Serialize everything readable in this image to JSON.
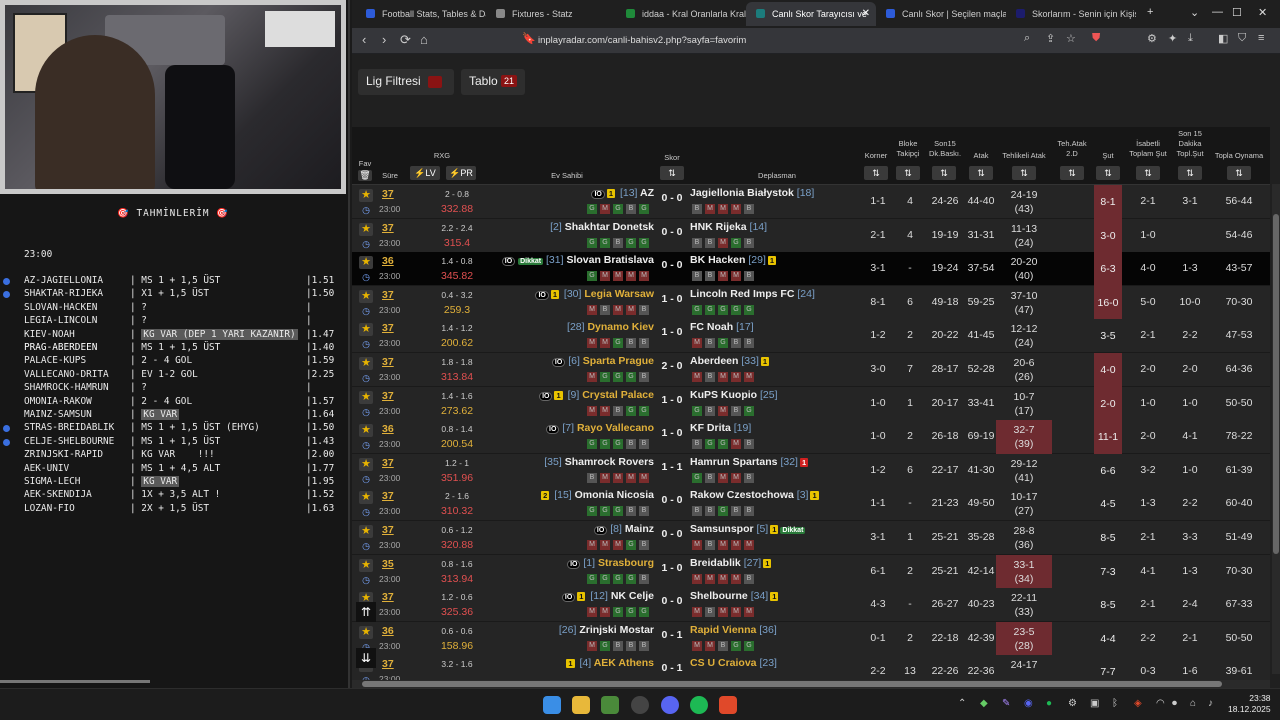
{
  "predictions": {
    "title": "🎯 TAHMİNLERİM 🎯",
    "time": "23:00",
    "items": [
      {
        "match": "AZ-JAGIELLONIA",
        "bet": "MS 1 + 1,5 ÜST",
        "odds": "1.51",
        "dot": true,
        "kg": false
      },
      {
        "match": "SHAKTAR-RIJEKA",
        "bet": "X1 + 1,5 ÜST",
        "odds": "1.50",
        "dot": true,
        "kg": false
      },
      {
        "match": "SLOVAN-HACKEN",
        "bet": "?",
        "odds": "",
        "dot": false,
        "kg": false
      },
      {
        "match": "LEGIA-LINCOLN",
        "bet": "?",
        "odds": "",
        "dot": false,
        "kg": false
      },
      {
        "match": "KIEV-NOAH",
        "bet": "KG VAR (DEP 1 YARI KAZANIR)",
        "odds": "1.47",
        "dot": false,
        "kg": true
      },
      {
        "match": "PRAG-ABERDEEN",
        "bet": "MS 1 + 1,5 ÜST",
        "odds": "1.40",
        "dot": false,
        "kg": false,
        "hl": true
      },
      {
        "match": "PALACE-KUPS",
        "bet": "2 - 4 GOL",
        "odds": "1.59",
        "dot": false,
        "kg": false
      },
      {
        "match": "VALLECANO-DRITA",
        "bet": "EV 1-2 GOL",
        "odds": "2.25",
        "dot": false,
        "kg": false
      },
      {
        "match": "SHAMROCK-HAMRUN",
        "bet": "?",
        "odds": "",
        "dot": false,
        "kg": false
      },
      {
        "match": "OMONIA-RAKOW",
        "bet": "2 - 4 GOL",
        "odds": "1.57",
        "dot": false,
        "kg": false
      },
      {
        "match": "MAINZ-SAMSUN",
        "bet": "KG VAR",
        "odds": "1.64",
        "dot": false,
        "kg": true
      },
      {
        "match": "STRAS-BREIDABLIK",
        "bet": "MS 1 + 1,5 ÜST (EHYG)",
        "odds": "1.50",
        "dot": true,
        "kg": false
      },
      {
        "match": "CELJE-SHELBOURNE",
        "bet": "MS 1 + 1,5 ÜST",
        "odds": "1.43",
        "dot": true,
        "kg": false
      },
      {
        "match": "ZRINJSKI-RAPID",
        "bet": "KG VAR    !!!",
        "odds": "2.00",
        "dot": false,
        "kg": false
      },
      {
        "match": "AEK-UNIV",
        "bet": "MS 1 + 4,5 ALT",
        "odds": "1.77",
        "dot": false,
        "kg": false
      },
      {
        "match": "SIGMA-LECH",
        "bet": "KG VAR",
        "odds": "1.95",
        "dot": false,
        "kg": true
      },
      {
        "match": "AEK-SKENDIJA",
        "bet": "1X + 3,5 ALT !",
        "odds": "1.52",
        "dot": false,
        "kg": false
      },
      {
        "match": "LOZAN-FIO",
        "bet": "2X + 1,5 ÜST",
        "odds": "1.63",
        "dot": false,
        "kg": false
      }
    ]
  },
  "browser": {
    "tabs": [
      {
        "label": "Football Stats, Tables & Dat",
        "color": "#2d5bd8"
      },
      {
        "label": "Fixtures - Statz",
        "color": "#888"
      },
      {
        "label": "iddaa - Kral Oranlarla Kralla",
        "color": "#1f8a3a"
      },
      {
        "label": "Canlı Skor Tarayıcısı ve",
        "color": "#1c7c7c",
        "active": true
      },
      {
        "label": "Canlı Skor | Seçilen maçlar",
        "color": "#2d5bd8"
      },
      {
        "label": "Skorlarım - Senin için Kişise",
        "color": "#1c1c6c"
      }
    ],
    "url": "inplayradar.com/canli-bahisv2.php?sayfa=favorim"
  },
  "toolbar": {
    "lig_label": "Lig Filtresi",
    "tablo_label": "Tablo",
    "tablo_count": "21"
  },
  "headers": {
    "fav": "Fav",
    "sure": "Süre",
    "rxg": "RXG",
    "lv": "⚡LV",
    "pr": "⚡PR",
    "ev": "Ev Sahibi",
    "skor": "Skor",
    "dep": "Deplasman",
    "korner": "Korner",
    "bloke": "Bloke Takipçi",
    "son15": "Son15 Dk.Baskı.",
    "atak": "Atak",
    "tehlikeli": "Tehlikeli Atak",
    "teh2d": "Teh.Atak 2.D",
    "sut": "Şut",
    "isabetli": "İsabetli Toplam Şut",
    "son15sut": "Son 15 Dakika Topl.Şut",
    "topla": "Topla Oynama"
  },
  "matches": [
    {
      "min": "37",
      "ko": "23:00",
      "xg": "2 - 0.8",
      "pr": "332.88",
      "home": "AZ",
      "hrank": "[13]",
      "hcards": "1",
      "hio": true,
      "score": "0 - 0",
      "away": "Jagiellonia Białystok",
      "arank": "[18]",
      "hform": [
        "G",
        "M",
        "G",
        "B",
        "G"
      ],
      "aform": [
        "B",
        "M",
        "M",
        "M",
        "B"
      ],
      "korner": "1-1",
      "bloke": "4",
      "son15": "24-26",
      "atak": "44-40",
      "teh": "24-19",
      "teh2": "(43)",
      "sut": "8-1",
      "isa": "2-1",
      "s15": "3-1",
      "top": "56-44",
      "hotsut": true
    },
    {
      "min": "37",
      "ko": "23:00",
      "xg": "2.2 - 2.4",
      "pr": "315.4",
      "home": "Shakhtar Donetsk",
      "hrank": "[2]",
      "score": "0 - 0",
      "away": "HNK Rijeka",
      "arank": "[14]",
      "hform": [
        "G",
        "G",
        "B",
        "G",
        "G"
      ],
      "aform": [
        "B",
        "B",
        "M",
        "G",
        "B"
      ],
      "korner": "2-1",
      "bloke": "4",
      "son15": "19-19",
      "atak": "31-31",
      "teh": "11-13",
      "teh2": "(24)",
      "sut": "3-0",
      "isa": "1-0",
      "s15": "",
      "top": "54-46",
      "hotsut": true
    },
    {
      "min": "36",
      "ko": "23:00",
      "xg": "1.4 - 0.8",
      "pr": "345.82",
      "home": "Slovan Bratislava",
      "hrank": "[31]",
      "hio": true,
      "hdk": "Dikkat",
      "score": "0 - 0",
      "away": "BK Hacken",
      "arank": "[29]",
      "acards": "1",
      "hform": [
        "G",
        "M",
        "M",
        "M",
        "M"
      ],
      "aform": [
        "B",
        "B",
        "M",
        "M",
        "B"
      ],
      "korner": "3-1",
      "bloke": "-",
      "son15": "19-24",
      "atak": "37-54",
      "teh": "20-20",
      "teh2": "(40)",
      "sut": "6-3",
      "isa": "4-0",
      "s15": "1-3",
      "top": "43-57",
      "sel": true,
      "hotsut": true
    },
    {
      "min": "37",
      "ko": "23:00",
      "xg": "0.4 - 3.2",
      "pr": "259.3",
      "home": "Legia Warsaw",
      "hrank": "[30]",
      "hcards": "1",
      "hio": true,
      "score": "1 - 0",
      "away": "Lincoln Red Imps FC",
      "arank": "[24]",
      "hform": [
        "M",
        "B",
        "M",
        "M",
        "B"
      ],
      "aform": [
        "G",
        "G",
        "G",
        "G",
        "G"
      ],
      "korner": "8-1",
      "bloke": "6",
      "son15": "49-18",
      "atak": "59-25",
      "teh": "37-10",
      "teh2": "(47)",
      "sut": "16-0",
      "isa": "5-0",
      "s15": "10-0",
      "top": "70-30",
      "hotsut": true,
      "hotson": true,
      "gold": true
    },
    {
      "min": "37",
      "ko": "23:00",
      "xg": "1.4 - 1.2",
      "pr": "200.62",
      "home": "Dynamo Kiev",
      "hrank": "[28]",
      "score": "1 - 0",
      "away": "FC Noah",
      "arank": "[17]",
      "hform": [
        "M",
        "M",
        "G",
        "B",
        "B"
      ],
      "aform": [
        "M",
        "B",
        "G",
        "B",
        "B"
      ],
      "korner": "1-2",
      "bloke": "2",
      "son15": "20-22",
      "atak": "41-45",
      "teh": "12-12",
      "teh2": "(24)",
      "sut": "3-5",
      "isa": "2-1",
      "s15": "2-2",
      "top": "47-53",
      "gold": true
    },
    {
      "min": "37",
      "ko": "23:00",
      "xg": "1.8 - 1.8",
      "pr": "313.84",
      "home": "Sparta Prague",
      "hrank": "[6]",
      "hio": true,
      "score": "2 - 0",
      "away": "Aberdeen",
      "arank": "[33]",
      "acards": "1",
      "hform": [
        "M",
        "G",
        "G",
        "G",
        "B"
      ],
      "aform": [
        "M",
        "B",
        "M",
        "M",
        "M"
      ],
      "korner": "3-0",
      "bloke": "7",
      "son15": "28-17",
      "atak": "52-28",
      "teh": "20-6",
      "teh2": "(26)",
      "sut": "4-0",
      "isa": "2-0",
      "s15": "2-0",
      "top": "64-36",
      "hotsut": true,
      "hotson": true,
      "gold": true
    },
    {
      "min": "37",
      "ko": "23:00",
      "xg": "1.4 - 1.6",
      "pr": "273.62",
      "home": "Crystal Palace",
      "hrank": "[9]",
      "hcards": "1",
      "hio": true,
      "score": "1 - 0",
      "away": "KuPS Kuopio",
      "arank": "[25]",
      "hform": [
        "M",
        "M",
        "B",
        "G",
        "G"
      ],
      "aform": [
        "G",
        "B",
        "M",
        "B",
        "G"
      ],
      "korner": "1-0",
      "bloke": "1",
      "son15": "20-17",
      "atak": "33-41",
      "teh": "10-7",
      "teh2": "(17)",
      "sut": "2-0",
      "isa": "1-0",
      "s15": "1-0",
      "top": "50-50",
      "hotsut": true,
      "gold": true
    },
    {
      "min": "36",
      "ko": "23:00",
      "xg": "0.8 - 1.4",
      "pr": "200.54",
      "home": "Rayo Vallecano",
      "hrank": "[7]",
      "hio": true,
      "score": "1 - 0",
      "away": "KF Drita",
      "arank": "[19]",
      "hform": [
        "G",
        "G",
        "G",
        "B",
        "B"
      ],
      "aform": [
        "B",
        "G",
        "G",
        "M",
        "B"
      ],
      "korner": "1-0",
      "bloke": "2",
      "son15": "26-18",
      "atak": "69-19",
      "teh": "32-7",
      "teh2": "(39)",
      "sut": "11-1",
      "isa": "2-0",
      "s15": "4-1",
      "top": "78-22",
      "hotsut": true,
      "hotteh": true,
      "gold": true
    },
    {
      "min": "37",
      "ko": "23:00",
      "xg": "1.2 - 1",
      "pr": "351.96",
      "home": "Shamrock Rovers",
      "hrank": "[35]",
      "score": "1 - 1",
      "away": "Hamrun Spartans",
      "arank": "[32]",
      "arcards": "1",
      "hform": [
        "B",
        "M",
        "M",
        "M",
        "M"
      ],
      "aform": [
        "G",
        "B",
        "M",
        "M",
        "B"
      ],
      "korner": "1-2",
      "bloke": "6",
      "son15": "22-17",
      "atak": "41-30",
      "teh": "29-12",
      "teh2": "(41)",
      "sut": "6-6",
      "isa": "3-2",
      "s15": "1-0",
      "top": "61-39"
    },
    {
      "min": "37",
      "ko": "23:00",
      "xg": "2 - 1.6",
      "pr": "310.32",
      "home": "Omonia Nicosia",
      "hrank": "[15]",
      "hcards": "2",
      "score": "0 - 0",
      "away": "Rakow Czestochowa",
      "arank": "[3]",
      "acards": "1",
      "hform": [
        "G",
        "G",
        "G",
        "B",
        "B"
      ],
      "aform": [
        "B",
        "B",
        "G",
        "B",
        "B"
      ],
      "korner": "1-1",
      "bloke": "-",
      "son15": "21-23",
      "atak": "49-50",
      "teh": "10-17",
      "teh2": "(27)",
      "sut": "4-5",
      "isa": "1-3",
      "s15": "2-2",
      "top": "60-40"
    },
    {
      "min": "37",
      "ko": "23:00",
      "xg": "0.6 - 1.2",
      "pr": "320.88",
      "home": "Mainz",
      "hrank": "[8]",
      "hio": true,
      "score": "0 - 0",
      "away": "Samsunspor",
      "arank": "[5]",
      "acards": "1",
      "adk": "Dikkat",
      "hform": [
        "M",
        "M",
        "M",
        "G",
        "B"
      ],
      "aform": [
        "M",
        "B",
        "M",
        "M",
        "M"
      ],
      "korner": "3-1",
      "bloke": "1",
      "son15": "25-21",
      "atak": "35-28",
      "teh": "28-8",
      "teh2": "(36)",
      "sut": "8-5",
      "isa": "2-1",
      "s15": "3-3",
      "top": "51-49"
    },
    {
      "min": "35",
      "ko": "23:00",
      "xg": "0.8 - 1.6",
      "pr": "313.94",
      "home": "Strasbourg",
      "hrank": "[1]",
      "hio": true,
      "score": "1 - 0",
      "away": "Breidablik",
      "arank": "[27]",
      "acards": "1",
      "hform": [
        "G",
        "G",
        "G",
        "G",
        "B"
      ],
      "aform": [
        "M",
        "M",
        "M",
        "M",
        "B"
      ],
      "korner": "6-1",
      "bloke": "2",
      "son15": "25-21",
      "atak": "42-14",
      "teh": "33-1",
      "teh2": "(34)",
      "sut": "7-3",
      "isa": "4-1",
      "s15": "1-3",
      "top": "70-30",
      "hotteh": true,
      "gold": true
    },
    {
      "min": "37",
      "ko": "23:00",
      "xg": "1.2 - 0.6",
      "pr": "325.36",
      "home": "NK Celje",
      "hrank": "[12]",
      "hcards": "1",
      "hio": true,
      "score": "0 - 0",
      "away": "Shelbourne",
      "arank": "[34]",
      "acards": "1",
      "hform": [
        "M",
        "M",
        "G",
        "G",
        "G"
      ],
      "aform": [
        "M",
        "B",
        "M",
        "M",
        "M"
      ],
      "korner": "4-3",
      "bloke": "-",
      "son15": "26-27",
      "atak": "40-23",
      "teh": "22-11",
      "teh2": "(33)",
      "sut": "8-5",
      "isa": "2-1",
      "s15": "2-4",
      "top": "67-33"
    },
    {
      "min": "36",
      "ko": "23:00",
      "xg": "0.6 - 0.6",
      "pr": "158.96",
      "home": "Zrinjski Mostar",
      "hrank": "[26]",
      "score": "0 - 1",
      "away": "Rapid Vienna",
      "arank": "[36]",
      "hform": [
        "M",
        "G",
        "B",
        "B",
        "B"
      ],
      "aform": [
        "M",
        "M",
        "B",
        "G",
        "G"
      ],
      "korner": "0-1",
      "bloke": "2",
      "son15": "22-18",
      "atak": "42-39",
      "teh": "23-5",
      "teh2": "(28)",
      "sut": "4-4",
      "isa": "2-2",
      "s15": "2-1",
      "top": "50-50",
      "hotteh": true,
      "agold": true,
      "white": true
    },
    {
      "min": "37",
      "ko": "23:00",
      "xg": "3.2 - 1.6",
      "pr": "",
      "home": "AEK Athens",
      "hrank": "[4]",
      "hcards": "1",
      "score": "0 - 1",
      "away": "CS U Craiova",
      "arank": "[23]",
      "hform": [],
      "aform": [],
      "korner": "2-2",
      "bloke": "13",
      "son15": "22-26",
      "atak": "22-36",
      "teh": "24-17",
      "teh2": "",
      "sut": "7-7",
      "isa": "0-3",
      "s15": "1-6",
      "top": "39-61",
      "gold": true,
      "agold": true
    }
  ],
  "taskbar": {
    "time": "23:38",
    "date": "18.12.2025"
  }
}
